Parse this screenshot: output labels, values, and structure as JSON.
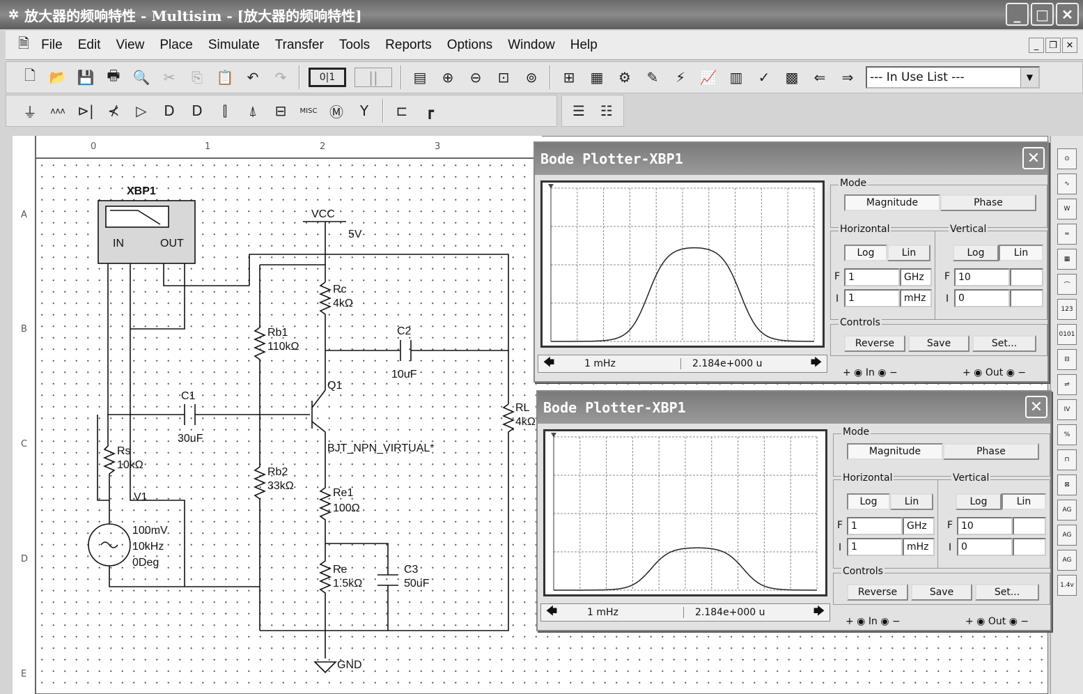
{
  "title": "放大器的频响特性 - Multisim - [放大器的频响特性]",
  "menu": [
    "File",
    "Edit",
    "View",
    "Place",
    "Simulate",
    "Transfer",
    "Tools",
    "Reports",
    "Options",
    "Window",
    "Help"
  ],
  "toolbar1": [
    "new-icon",
    "open-icon",
    "save-icon",
    "print-icon",
    "print-preview-icon",
    "cut-icon",
    "copy-icon",
    "paste-icon",
    "undo-icon",
    "redo-icon"
  ],
  "in_use_list": "--- In Use List ---",
  "toolbar2": [
    "source-icon",
    "resistor-icon",
    "diode-icon",
    "transistor-icon",
    "analog-icon",
    "ttl-icon",
    "cmos-icon",
    "mixed-icon",
    "indicator-icon",
    "misc-digital-icon",
    "misc-icon",
    "electromech-icon",
    "rf-icon",
    "hierarchical-block-icon",
    "bus-icon"
  ],
  "ruler": {
    "top": [
      "0",
      "1",
      "2",
      "3"
    ],
    "left": [
      "A",
      "B",
      "C",
      "D",
      "E"
    ]
  },
  "circuit": {
    "xbp1": "XBP1",
    "in": "IN",
    "out": "OUT",
    "vcc": "VCC",
    "vcc_val": "5V",
    "rc": "Rc",
    "rc_val": "4kΩ",
    "rb1": "Rb1",
    "rb1_val": "110kΩ",
    "c2": "C2",
    "c2_val": "10uF",
    "q1": "Q1",
    "q1_model": "BJT_NPN_VIRTUAL*",
    "c1": "C1",
    "c1_val": "30uF",
    "rl": "RL",
    "rl_val": "4kΩ",
    "rs": "Rs",
    "rs_val": "10kΩ",
    "rb2": "Rb2",
    "rb2_val": "33kΩ",
    "re1": "Re1",
    "re1_val": "100Ω",
    "v1": "V1",
    "v1_amp": "100mV",
    "v1_freq": "10kHz",
    "v1_phase": "0Deg",
    "re": "Re",
    "re_val": "1.5kΩ",
    "c3": "C3",
    "c3_val": "50uF",
    "gnd": "GND"
  },
  "bode": [
    {
      "title": "Bode Plotter-XBP1",
      "mode_label": "Mode",
      "magnitude": "Magnitude",
      "phase": "Phase",
      "mode": "Magnitude",
      "horizontal": "Horizontal",
      "vertical": "Vertical",
      "log": "Log",
      "lin": "Lin",
      "h_scale": "Log",
      "v_scale": "Lin",
      "h_f": "1",
      "h_f_unit": "GHz",
      "h_i": "1",
      "h_i_unit": "mHz",
      "v_f": "10",
      "v_i": "0",
      "f": "F",
      "i": "I",
      "controls": "Controls",
      "reverse": "Reverse",
      "save": "Save",
      "set": "Set...",
      "cursor_freq": "1 mHz",
      "cursor_val": "2.184e+000 u",
      "in": "In",
      "out": "Out",
      "plus": "+",
      "minus": "−",
      "peak": 0.62
    },
    {
      "title": "Bode Plotter-XBP1",
      "mode_label": "Mode",
      "magnitude": "Magnitude",
      "phase": "Phase",
      "mode": "Magnitude",
      "horizontal": "Horizontal",
      "vertical": "Vertical",
      "log": "Log",
      "lin": "Lin",
      "h_scale": "Log",
      "v_scale": "Lin",
      "h_f": "1",
      "h_f_unit": "GHz",
      "h_i": "1",
      "h_i_unit": "mHz",
      "v_f": "10",
      "v_i": "0",
      "f": "F",
      "i": "I",
      "controls": "Controls",
      "reverse": "Reverse",
      "save": "Save",
      "set": "Set...",
      "cursor_freq": "1 mHz",
      "cursor_val": "2.184e+000 u",
      "in": "In",
      "out": "Out",
      "plus": "+",
      "minus": "−",
      "peak": 0.28
    }
  ]
}
